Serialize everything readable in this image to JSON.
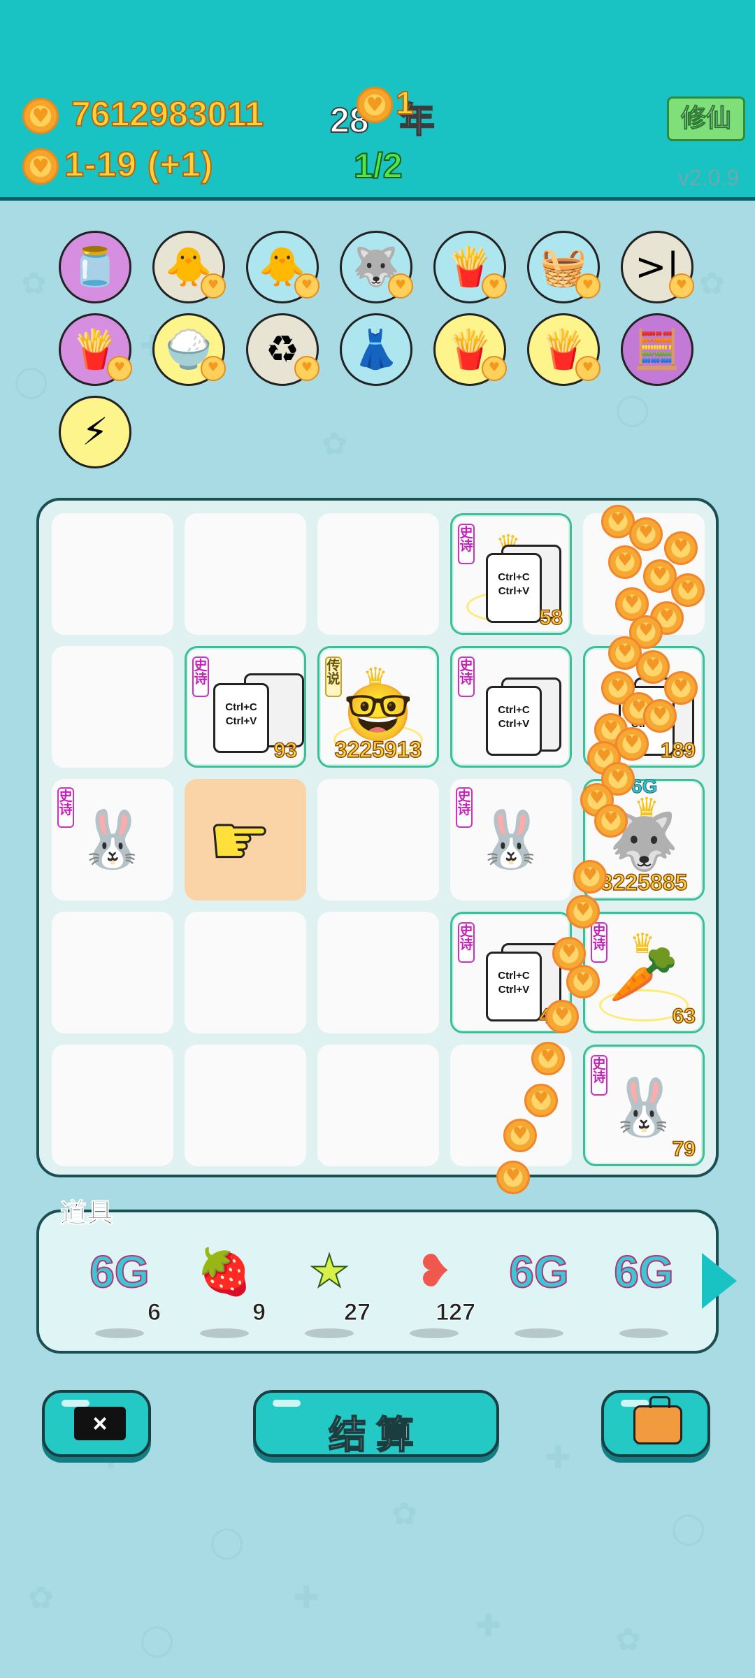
{
  "header": {
    "money": "7612983011",
    "rate": "1-19  (+1)",
    "year": "28",
    "year_pop": "1",
    "year_suffix": "年",
    "progress": "1/2",
    "cultivate_button": "修仙",
    "version": "v2.0.9"
  },
  "items": [
    {
      "icon": "jar-icon",
      "glyph": "🫙",
      "bg": "#d68ee0"
    },
    {
      "icon": "chick-egg-icon",
      "glyph": "🐥",
      "bg": "#e8e4d4"
    },
    {
      "icon": "chick-egg-icon-2",
      "glyph": "🐥",
      "bg": "#aee6f0"
    },
    {
      "icon": "husky-icon",
      "glyph": "🐺",
      "bg": "#aee6f0"
    },
    {
      "icon": "fries-icon",
      "glyph": "🍟",
      "bg": "#aee6f0"
    },
    {
      "icon": "fruit-basket-icon",
      "glyph": "🧺",
      "bg": "#aee6f0"
    },
    {
      "icon": "skip-icon",
      "glyph": ">|",
      "bg": "#e8e4d4"
    },
    {
      "icon": "fries-icon-2",
      "glyph": "🍟",
      "bg": "#d68ee0"
    },
    {
      "icon": "rice-bowl-icon",
      "glyph": "🍚",
      "bg": "#fdf58c"
    },
    {
      "icon": "recycle-icon",
      "glyph": "♻",
      "bg": "#e8e4d4"
    },
    {
      "icon": "skirt-icon",
      "glyph": "👗",
      "bg": "#aee6f0"
    },
    {
      "icon": "fries-icon-3",
      "glyph": "🍟",
      "bg": "#fdf58c"
    },
    {
      "icon": "fries-icon-4",
      "glyph": "🍟",
      "bg": "#fdf58c"
    },
    {
      "icon": "math-head-icon",
      "glyph": "🧮",
      "bg": "#c27ad6"
    },
    {
      "icon": "lightning-icon",
      "glyph": "⚡",
      "bg": "#fdf58c"
    }
  ],
  "board": {
    "tag_epic": "史诗",
    "tag_legend": "传说",
    "copy_text_1": "Ctrl+C",
    "copy_text_2": "Ctrl+V",
    "level_58": "58",
    "level_93": "93",
    "level_3225913": "3225913",
    "level_189": "189",
    "level_6g_label": "6G",
    "level_3225885": "3225885",
    "level_47": "47",
    "level_63": "63",
    "level_79": "79"
  },
  "props": {
    "title": "道具",
    "items": [
      {
        "name": "6G",
        "count": "6"
      },
      {
        "name": "lychee",
        "count": "9"
      },
      {
        "name": "star",
        "count": "27"
      },
      {
        "name": "liver",
        "count": "127"
      },
      {
        "name": "6G",
        "count": ""
      },
      {
        "name": "6G",
        "count": ""
      }
    ]
  },
  "buttons": {
    "close": "×",
    "settle": "结算"
  }
}
